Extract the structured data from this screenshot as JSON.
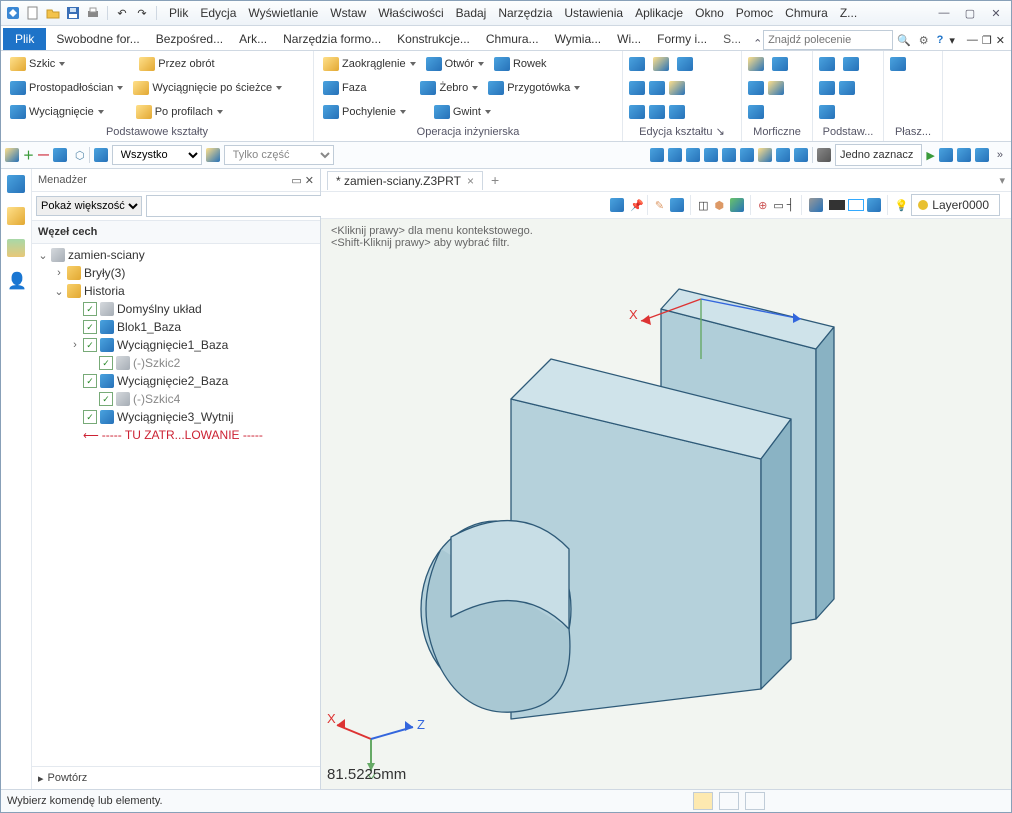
{
  "menu": {
    "items": [
      "Plik",
      "Edycja",
      "Wyświetlanie",
      "Wstaw",
      "Właściwości",
      "Badaj",
      "Narzędzia",
      "Ustawienia",
      "Aplikacje",
      "Okno",
      "Pomoc",
      "Chmura",
      "Z..."
    ]
  },
  "ribbon_tabs": {
    "file": "Plik",
    "tabs": [
      "Swobodne for...",
      "Bezpośred...",
      "Ark...",
      "Narzędzia formo...",
      "Konstrukcje...",
      "Chmura...",
      "Wymia...",
      "Wi...",
      "Formy i...",
      "S..."
    ]
  },
  "cmd_placeholder": "Znajdź polecenie",
  "rib": {
    "g1": {
      "szkic": "Szkic",
      "prosto": "Prostopadłościan",
      "wyc": "Wyciągnięcie",
      "obrot": "Przez obrót",
      "sciezka": "Wyciągnięcie po ścieżce",
      "profil": "Po profilach",
      "lbl": "Podstawowe kształty"
    },
    "g2": {
      "zaokr": "Zaokrąglenie",
      "faza": "Faza",
      "poch": "Pochylenie",
      "otwor": "Otwór",
      "zebro": "Żebro",
      "gwint": "Gwint",
      "rowek": "Rowek",
      "przyg": "Przygotówka",
      "lbl": "Operacja inżynierska"
    },
    "g3": {
      "lbl": "Edycja kształtu"
    },
    "g4": {
      "lbl": "Morficzne"
    },
    "g5": {
      "lbl": "Podstaw..."
    },
    "g6": {
      "lbl": "Płasz..."
    }
  },
  "sec": {
    "sel": "Wszystko",
    "sel2": "Tylko część",
    "sel3": "Jedno zaznacz"
  },
  "mgr": {
    "title": "Menadżer",
    "show": "Pokaż większość",
    "node": "Węzeł cech",
    "tree": [
      {
        "d": 0,
        "tw": "v",
        "txt": "zamien-sciany",
        "ico": "grey"
      },
      {
        "d": 1,
        "tw": ">",
        "txt": "Bryły(3)",
        "ico": "fold"
      },
      {
        "d": 1,
        "tw": "v",
        "txt": "Historia",
        "ico": "fold"
      },
      {
        "d": 2,
        "chk": true,
        "txt": "Domyślny układ",
        "ico": "grey"
      },
      {
        "d": 2,
        "chk": true,
        "txt": "Blok1_Baza",
        "ico": "blue"
      },
      {
        "d": 2,
        "tw": ">",
        "chk": true,
        "txt": "Wyciągnięcie1_Baza",
        "ico": "blue"
      },
      {
        "d": 3,
        "chk": true,
        "txt": "(-)Szkic2",
        "ico": "grey",
        "gray": true
      },
      {
        "d": 2,
        "chk": true,
        "txt": "Wyciągnięcie2_Baza",
        "ico": "blue"
      },
      {
        "d": 3,
        "chk": true,
        "txt": "(-)Szkic4",
        "ico": "grey",
        "gray": true
      },
      {
        "d": 2,
        "chk": true,
        "txt": "Wyciągnięcie3_Wytnij",
        "ico": "blue"
      },
      {
        "d": 2,
        "txt": "----- TU ZATR...LOWANIE -----",
        "red": true,
        "arrow": true
      }
    ],
    "foot": "Powtórz"
  },
  "doc": {
    "tab": "* zamien-sciany.Z3PRT"
  },
  "hints": {
    "l1": "<Kliknij prawy> dla menu kontekstowego.",
    "l2": "<Shift-Kliknij prawy> aby wybrać filtr."
  },
  "layer": "Layer0000",
  "axis": {
    "x": "X",
    "y": "Y",
    "z": "Z",
    "xt": "X"
  },
  "measure": "81.5225mm",
  "status": "Wybierz komendę lub elementy."
}
